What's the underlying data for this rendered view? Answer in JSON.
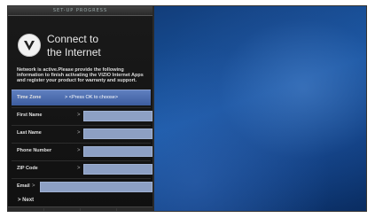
{
  "header": {
    "progress_label": "SET-UP PROGRESS"
  },
  "panel": {
    "title_line1": "Connect to",
    "title_line2": "the Internet",
    "info_text": "Network is active.Please provide the following information to finish activating the VIZIO Internet Apps and register your product for warranty and support."
  },
  "form": {
    "time_zone_label": "Time Zone",
    "time_zone_value": ">   <Press OK to choose>",
    "first_name_label": "First Name",
    "last_name_label": "Last Name",
    "phone_label": "Phone Number",
    "zip_label": "ZIP Code",
    "email_label": "Email",
    "arrow": ">",
    "next_label": "> Next"
  },
  "icons": {
    "logo": "vizio-v-logo"
  },
  "colors": {
    "selected_row": "#4a6aae",
    "field_fill": "#8da0c4",
    "wallpaper": "#1a5aa8"
  }
}
